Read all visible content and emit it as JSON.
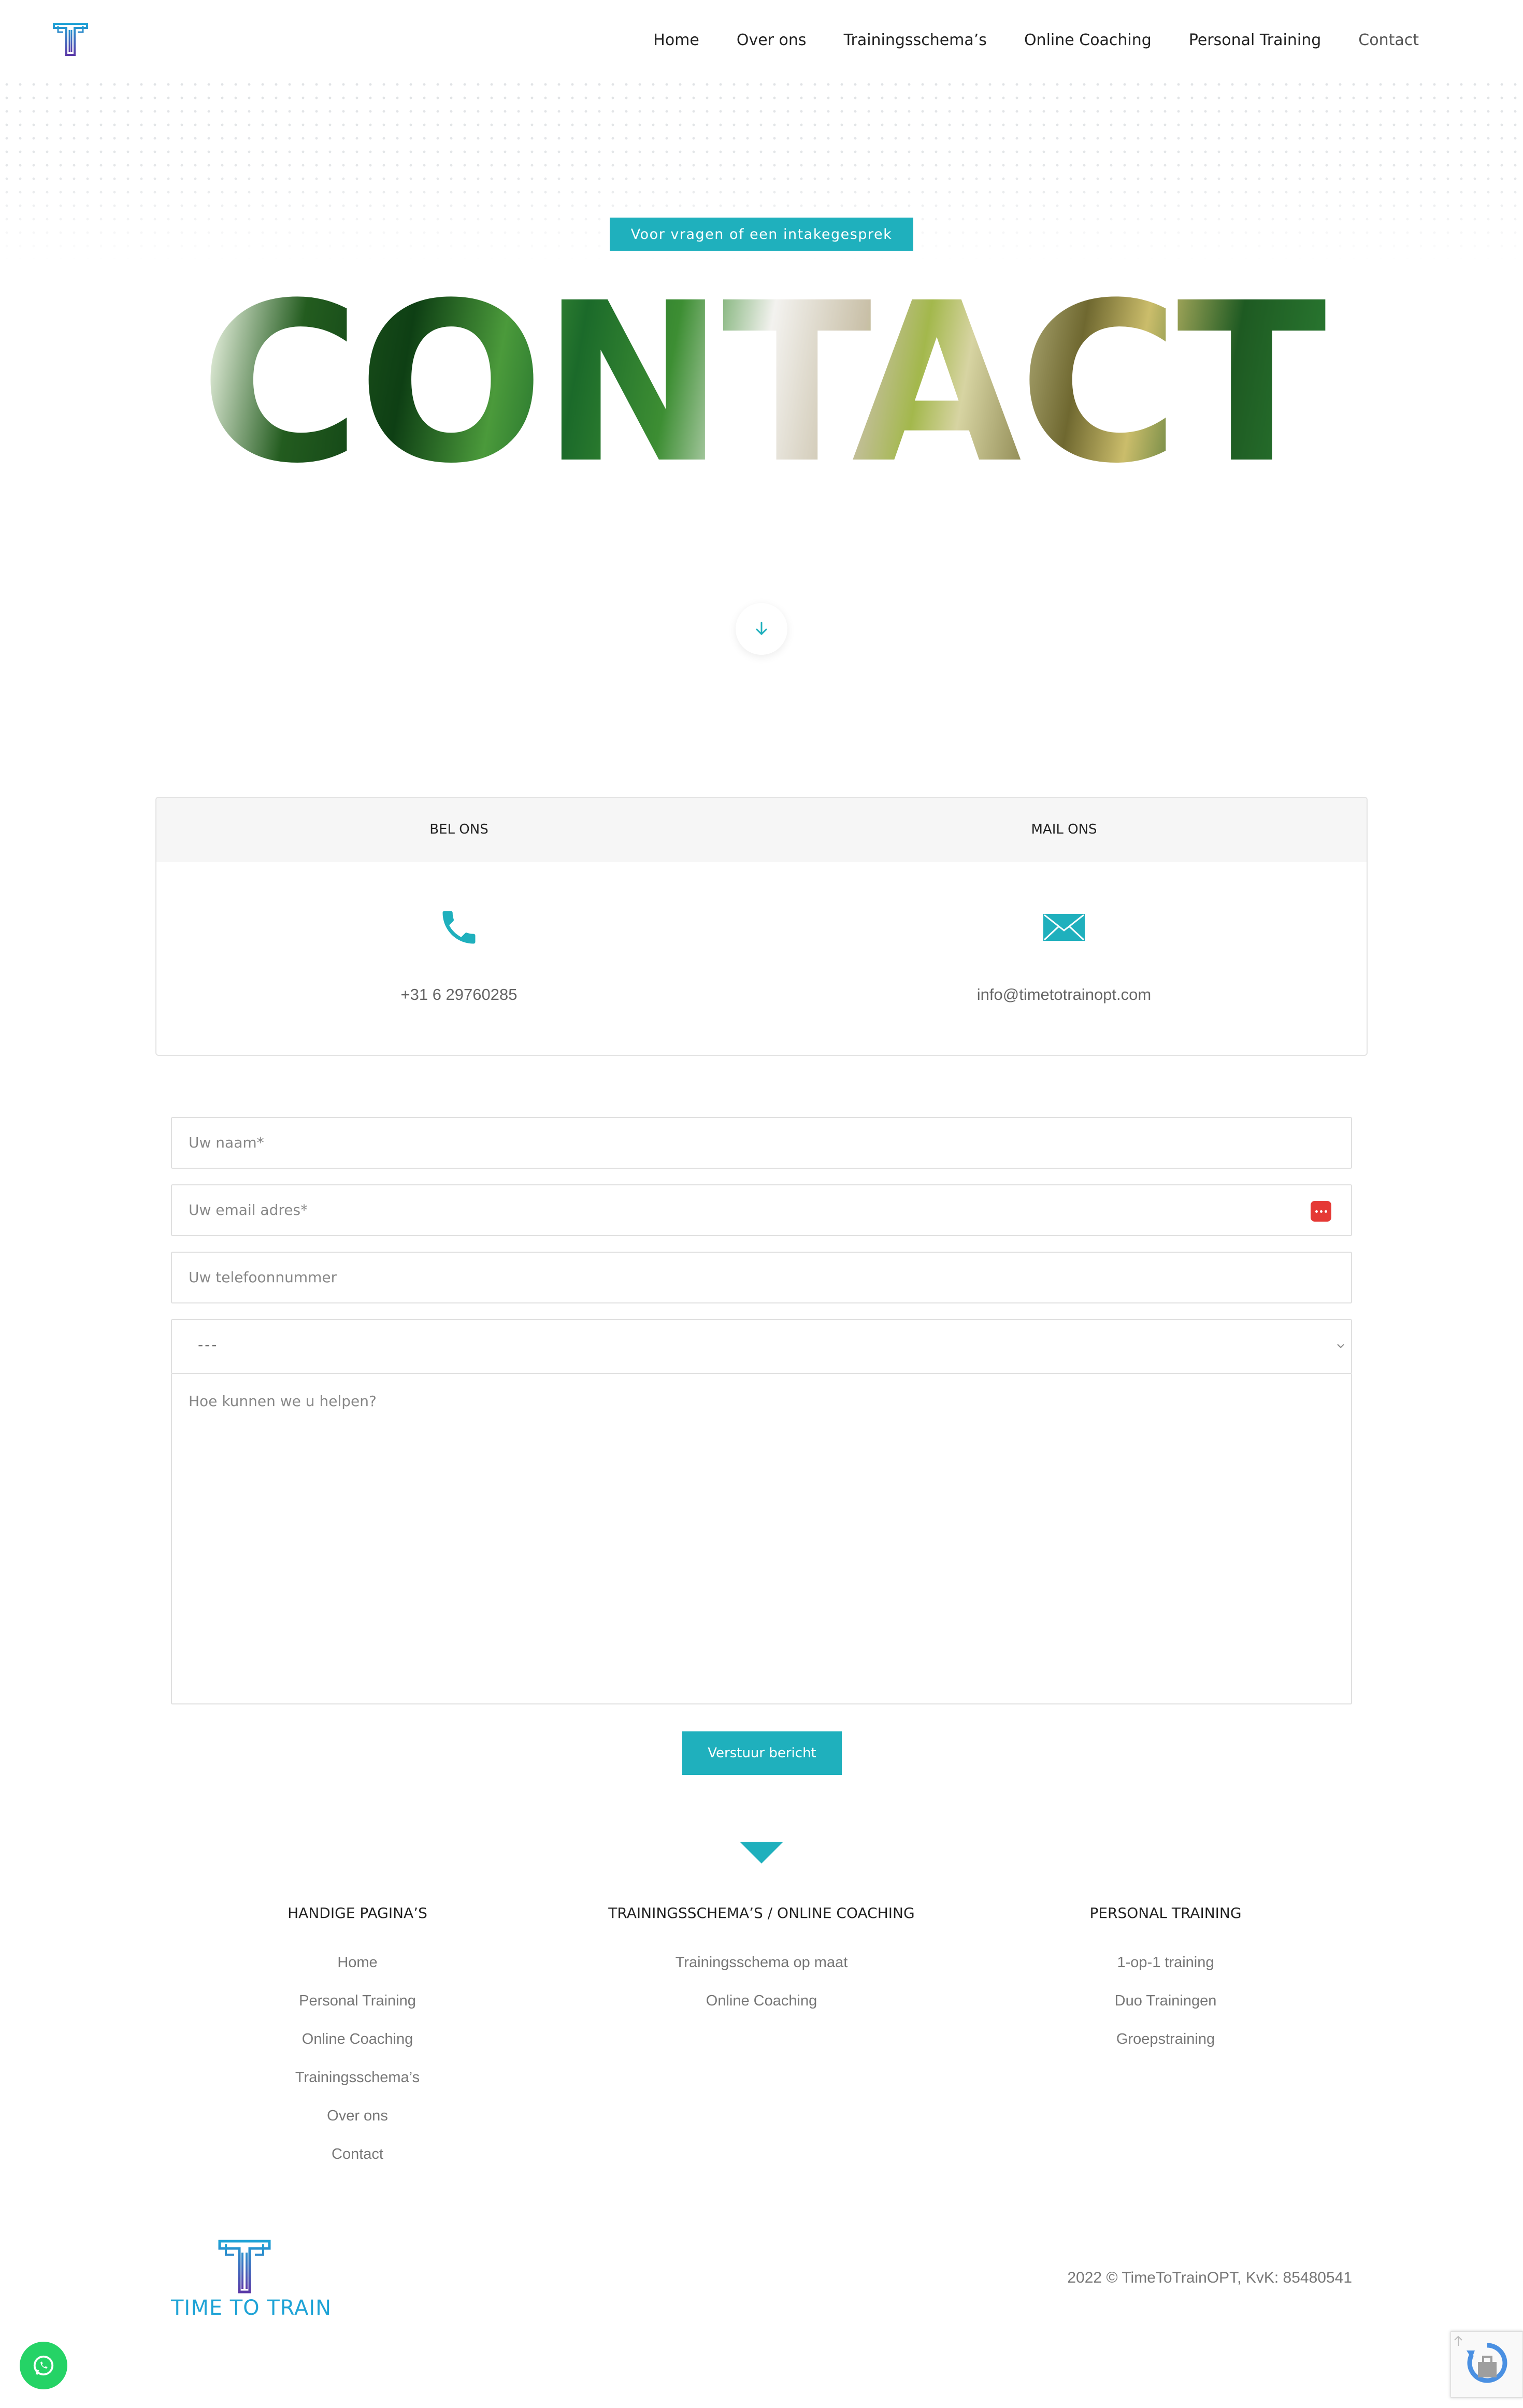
{
  "nav": {
    "items": [
      {
        "label": "Home"
      },
      {
        "label": "Over ons"
      },
      {
        "label": "Trainingsschema’s"
      },
      {
        "label": "Online Coaching"
      },
      {
        "label": "Personal Training"
      },
      {
        "label": "Contact"
      }
    ]
  },
  "hero": {
    "badge": "Voor vragen of een intakegesprek",
    "title": "CONTACT"
  },
  "contact_card": {
    "call_label": "BEL ONS",
    "call_value": "+31 6 29760285",
    "mail_label": "MAIL ONS",
    "mail_value": "info@timetotrainopt.com"
  },
  "form": {
    "name_placeholder": "Uw naam*",
    "email_placeholder": "Uw email adres*",
    "phone_placeholder": "Uw telefoonnummer",
    "select_value": "---",
    "message_placeholder": "Hoe kunnen we u helpen?",
    "submit_label": "Verstuur bericht"
  },
  "footer": {
    "col1_title": "HANDIGE PAGINA’S",
    "col1_links": [
      "Home",
      "Personal Training",
      "Online Coaching",
      "Trainingsschema’s",
      "Over ons",
      "Contact"
    ],
    "col2_title": "TRAININGSSCHEMA’S / ONLINE COACHING",
    "col2_links": [
      "Trainingsschema op maat",
      "Online Coaching"
    ],
    "col3_title": "PERSONAL TRAINING",
    "col3_links": [
      "1-op-1 training",
      "Duo Trainingen",
      "Groepstraining"
    ],
    "brand": "TIME TO TRAIN",
    "copyright": "2022 © TimeToTrainOPT, KvK: 85480541"
  },
  "colors": {
    "accent": "#1fb0bd",
    "brand_blue": "#1ea3d6",
    "brand_purple": "#5b3aa8",
    "whatsapp": "#25d366"
  },
  "icons": [
    "logo-icon",
    "chevron-down-icon",
    "phone-icon",
    "mail-icon",
    "password-manager-icon",
    "whatsapp-icon",
    "recaptcha-icon",
    "arrow-up-icon"
  ]
}
